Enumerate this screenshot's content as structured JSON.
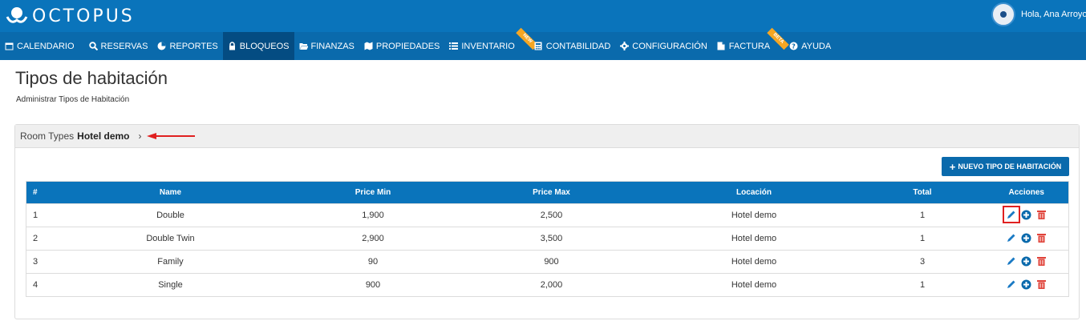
{
  "brand": {
    "logo_text": "OCTOPUS"
  },
  "user": {
    "greeting": "Hola, Ana Arroyo"
  },
  "nav": [
    {
      "label": "CALENDARIO",
      "icon": "calendar-icon"
    },
    {
      "label": "RESERVAS",
      "icon": "search-icon"
    },
    {
      "label": "REPORTES",
      "icon": "pie-chart-icon"
    },
    {
      "label": "BLOQUEOS",
      "icon": "lock-icon",
      "active": true
    },
    {
      "label": "FINANZAS",
      "icon": "folder-open-icon"
    },
    {
      "label": "PROPIEDADES",
      "icon": "map-icon"
    },
    {
      "label": "INVENTARIO",
      "icon": "list-icon",
      "ribbon": "NEW"
    },
    {
      "label": "CONTABILIDAD",
      "icon": "calculator-icon"
    },
    {
      "label": "CONFIGURACIÓN",
      "icon": "gear-icon"
    },
    {
      "label": "FACTURA",
      "icon": "file-icon",
      "ribbon": "BETA"
    },
    {
      "label": "AYUDA",
      "icon": "question-circle-icon"
    }
  ],
  "page": {
    "title": "Tipos de habitación",
    "subtitle": "Administrar Tipos de Habitación"
  },
  "breadcrumb": {
    "prefix": "Room Types",
    "hotel": "Hotel demo",
    "chevron": "›"
  },
  "toolbar": {
    "new_label": "NUEVO TIPO DE HABITACIÓN"
  },
  "table": {
    "columns": [
      "#",
      "Name",
      "Price Min",
      "Price Max",
      "Locación",
      "Total",
      "Acciones"
    ],
    "rows": [
      {
        "num": "1",
        "name": "Double",
        "min": "1,900",
        "max": "2,500",
        "loc": "Hotel demo",
        "total": "1"
      },
      {
        "num": "2",
        "name": "Double Twin",
        "min": "2,900",
        "max": "3,500",
        "loc": "Hotel demo",
        "total": "1"
      },
      {
        "num": "3",
        "name": "Family",
        "min": "90",
        "max": "900",
        "loc": "Hotel demo",
        "total": "3"
      },
      {
        "num": "4",
        "name": "Single",
        "min": "900",
        "max": "2,000",
        "loc": "Hotel demo",
        "total": "1"
      }
    ]
  },
  "colors": {
    "primary": "#0a74bb",
    "nav": "#0a6aac",
    "nav_active": "#044c82",
    "ribbon": "#f5a623",
    "delete": "#e0433a",
    "highlight": "#e02020"
  }
}
